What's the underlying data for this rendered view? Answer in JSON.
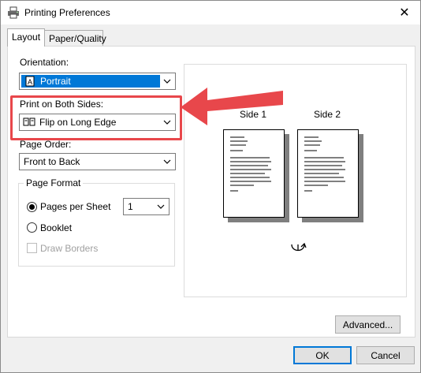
{
  "window": {
    "title": "Printing Preferences",
    "close_glyph": "✕"
  },
  "tabs": [
    {
      "label": "Layout",
      "active": true
    },
    {
      "label": "Paper/Quality",
      "active": false
    }
  ],
  "layout": {
    "orientation": {
      "label": "Orientation:",
      "value": "Portrait"
    },
    "both_sides": {
      "label": "Print on Both Sides:",
      "value": "Flip on Long Edge"
    },
    "page_order": {
      "label": "Page Order:",
      "value": "Front to Back"
    },
    "page_format": {
      "title": "Page Format",
      "pages_per_sheet": {
        "label": "Pages per Sheet",
        "selected": true,
        "value": "1"
      },
      "booklet": {
        "label": "Booklet",
        "selected": false
      },
      "draw_borders": {
        "label": "Draw Borders",
        "checked": false,
        "enabled": false
      }
    }
  },
  "preview": {
    "side1": "Side 1",
    "side2": "Side 2"
  },
  "buttons": {
    "advanced": "Advanced...",
    "ok": "OK",
    "cancel": "Cancel"
  },
  "colors": {
    "accent": "#0078d7",
    "highlight": "#e8474b"
  }
}
